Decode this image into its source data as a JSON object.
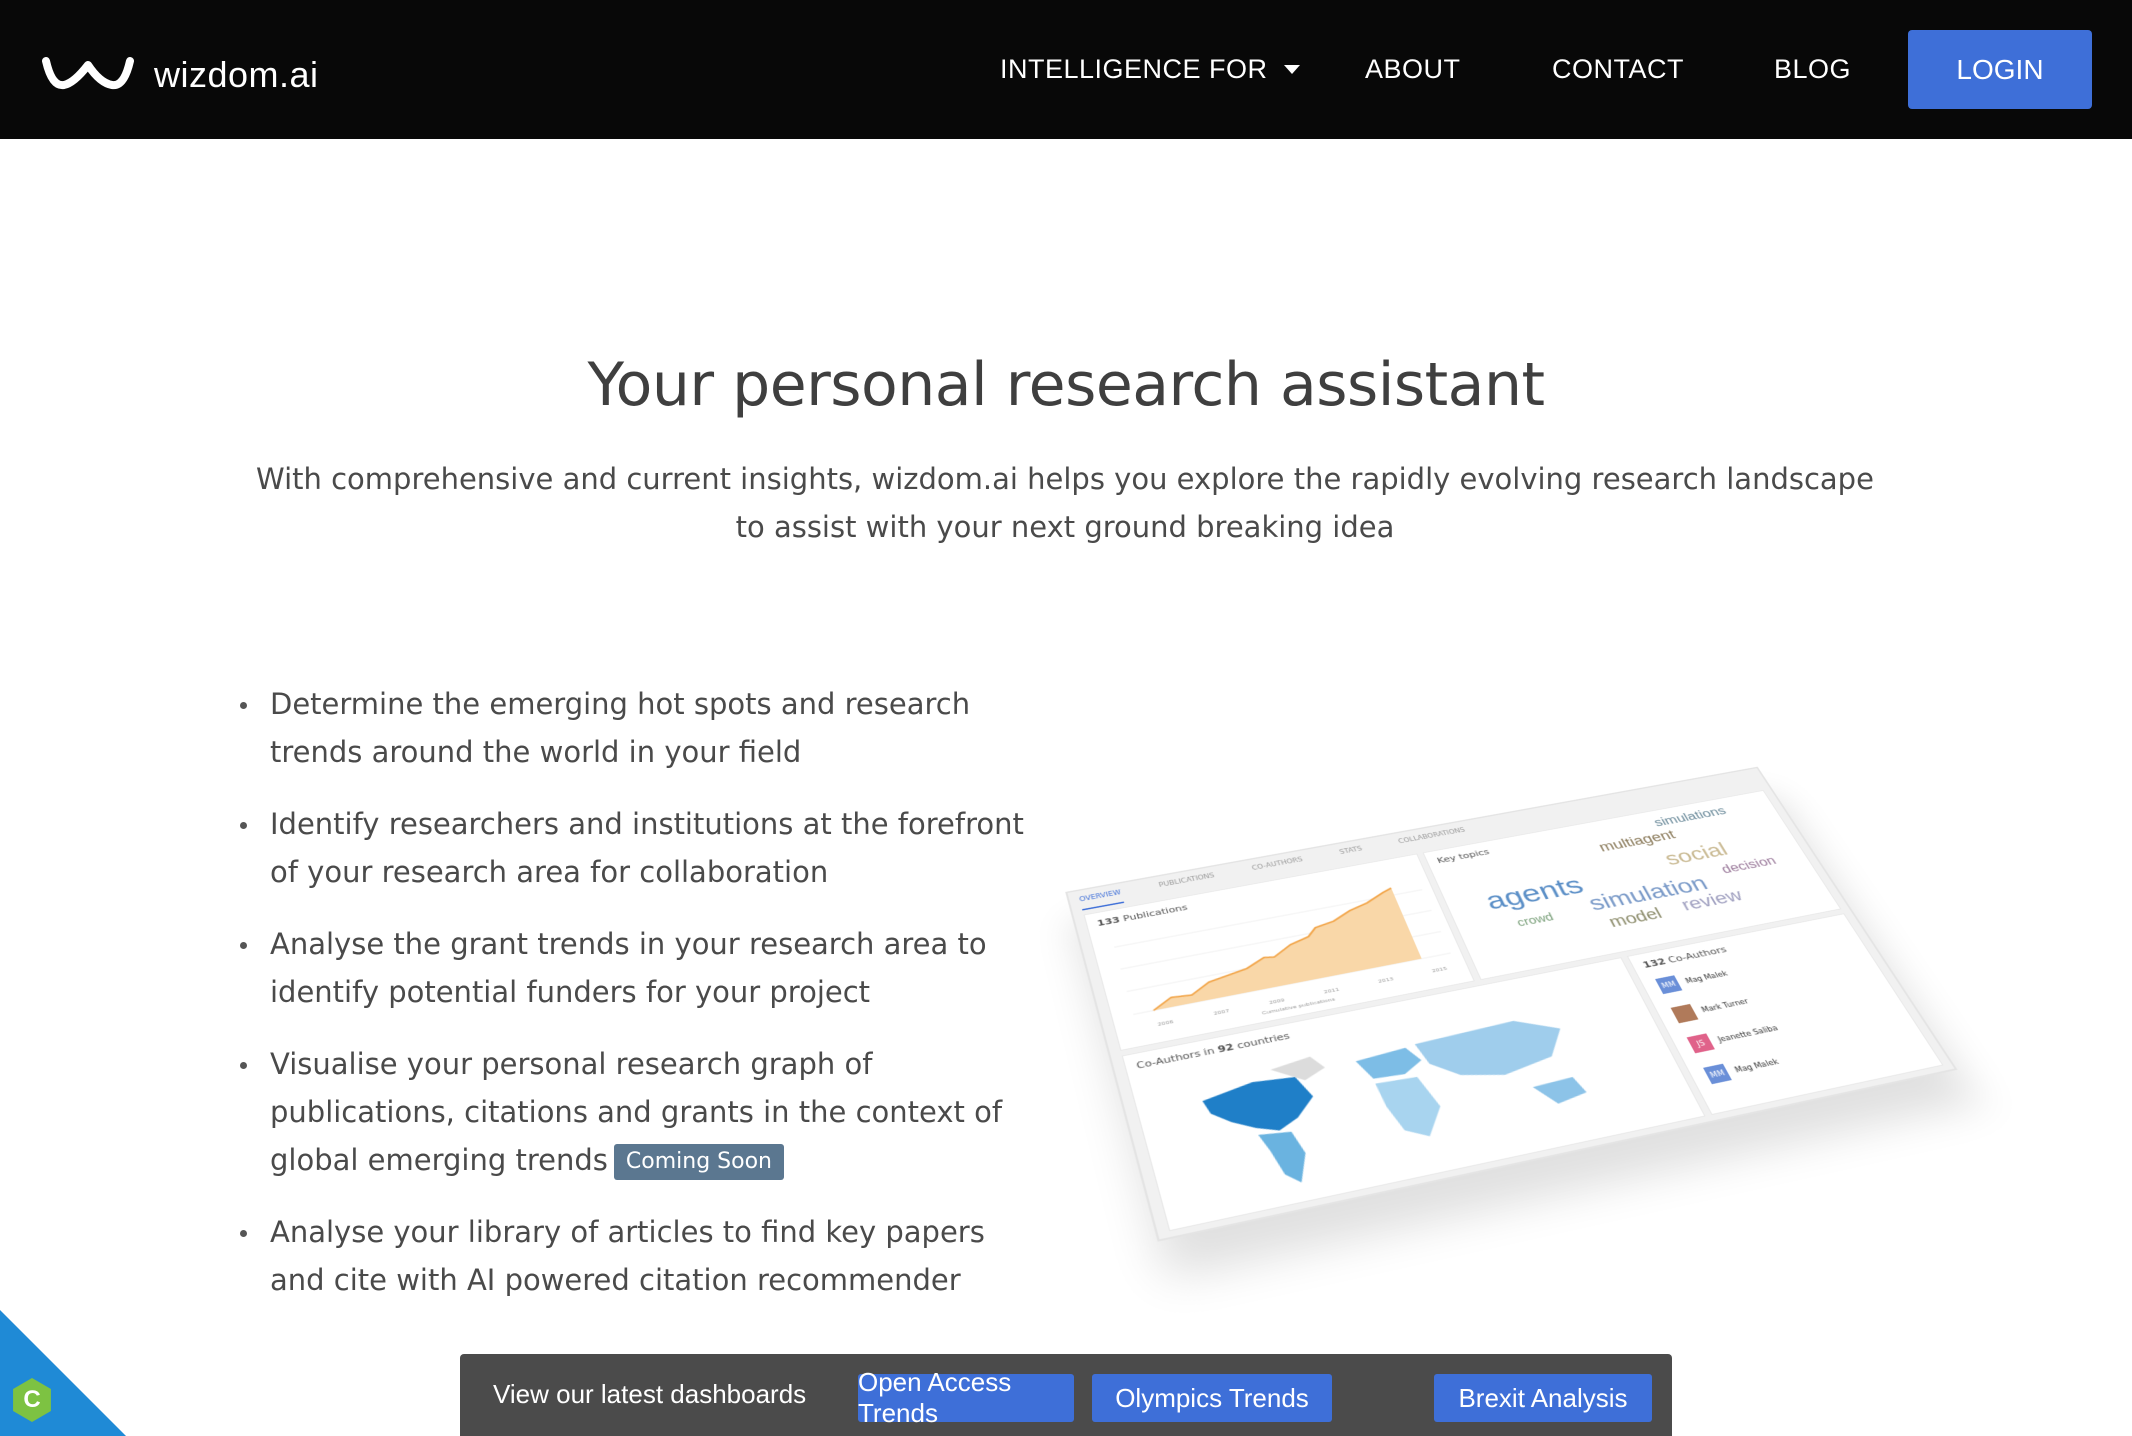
{
  "nav": {
    "brand": "wizdom.ai",
    "links": [
      "INTELLIGENCE FOR",
      "ABOUT",
      "CONTACT",
      "BLOG"
    ],
    "login": "LOGIN"
  },
  "hero": {
    "title": "Your personal research assistant",
    "subtitle": "With comprehensive and current insights, wizdom.ai helps you explore the rapidly evolving research landscape to assist with your next ground breaking idea"
  },
  "features": [
    "Determine the emerging hot spots and research trends around the world in your field",
    "Identify researchers and institutions at the forefront of your research area for collaboration",
    "Analyse the grant trends in your research area to identify potential funders for your project",
    "Visualise your personal research graph of publications, citations and grants in the context of global emerging trends",
    "Analyse your library of articles to find key papers and cite with AI powered citation recommender"
  ],
  "coming_soon": "Coming Soon",
  "preview": {
    "tabs": [
      "OVERVIEW",
      "PUBLICATIONS",
      "CO-AUTHORS",
      "STATS",
      "COLLABORATIONS"
    ],
    "publications_count": "133",
    "publications_label": "Publications",
    "cumulative_label": "Cumulative publications",
    "key_topics_label": "Key topics",
    "topics": [
      "agents",
      "simulation",
      "multiagent",
      "social",
      "model",
      "review",
      "decision",
      "crowd",
      "simulations"
    ],
    "coauthors_map_prefix": "Co-Authors in",
    "coauthors_countries": "92",
    "coauthors_map_suffix": "countries",
    "coauthors_count": "132",
    "coauthors_label": "Co-Authors",
    "coauthor_list": [
      {
        "initials": "MM",
        "name": "Mag Malek",
        "color": "#6a8fd8"
      },
      {
        "initials": "",
        "name": "Mark Turner",
        "color": "#b07a5a"
      },
      {
        "initials": "JS",
        "name": "Jeanette Saliba",
        "color": "#e0628a"
      },
      {
        "initials": "MM",
        "name": "Mag Malek",
        "color": "#6a8fd8"
      }
    ],
    "x_ticks": [
      "2006",
      "2007",
      "2009",
      "2011",
      "2013",
      "2015"
    ]
  },
  "dashboards": {
    "label": "View our latest dashboards",
    "buttons": [
      "Open Access Trends",
      "Olympics Trends",
      "Brexit Analysis"
    ]
  },
  "corner_badge": "C",
  "colors": {
    "nav_bg": "#080808",
    "accent": "#3e6fd8",
    "badge": "#5b7790",
    "bar_bg": "#4b4b4b"
  }
}
